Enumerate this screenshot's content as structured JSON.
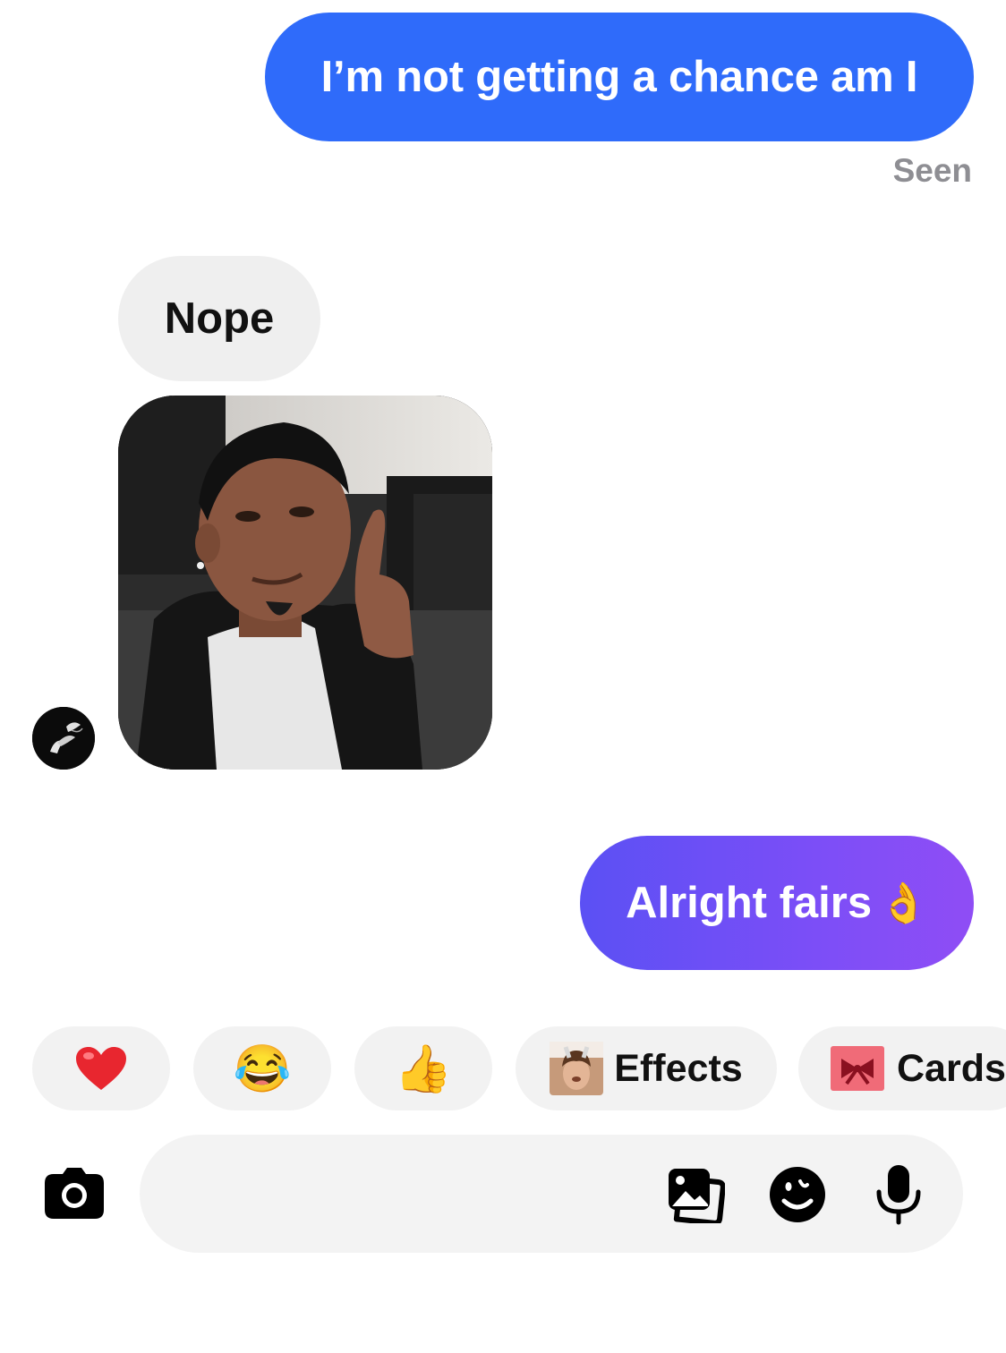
{
  "messages": {
    "outgoing_1": "I’m not getting a chance am I",
    "seen_label": "Seen",
    "incoming_1": "Nope",
    "outgoing_2": "Alright fairs"
  },
  "reactions": {
    "heart": "❤️",
    "laugh": "😂",
    "thumbs_up": "👍",
    "ok_hand": "👌"
  },
  "quick_actions": {
    "effects_label": "Effects",
    "cards_label": "Cards"
  },
  "composer": {
    "placeholder": ""
  },
  "icons": {
    "camera": "camera-icon",
    "gallery": "gallery-icon",
    "sticker": "sticker-icon",
    "microphone": "microphone-icon"
  },
  "colors": {
    "outgoing_blue": "#2f6bfa",
    "outgoing_purple": "#7c4ef7",
    "incoming_gray": "#efefef",
    "seen_gray": "#8e8e93"
  }
}
